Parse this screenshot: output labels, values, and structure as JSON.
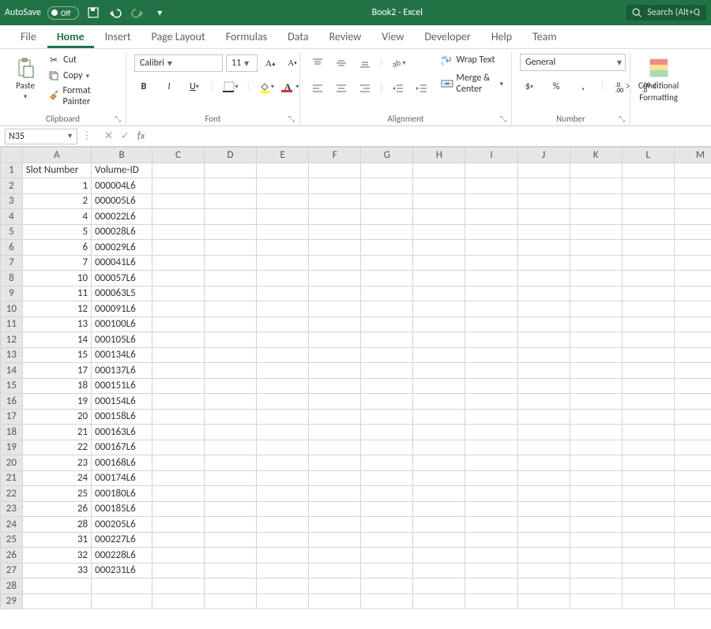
{
  "titlebar": {
    "autosave_label": "AutoSave",
    "autosave_state": "Off",
    "doc_title": "Book2  -  Excel",
    "search_placeholder": "Search (Alt+Q"
  },
  "tabs": [
    "File",
    "Home",
    "Insert",
    "Page Layout",
    "Formulas",
    "Data",
    "Review",
    "View",
    "Developer",
    "Help",
    "Team"
  ],
  "active_tab": "Home",
  "ribbon": {
    "clipboard": {
      "paste": "Paste",
      "cut": "Cut",
      "copy": "Copy",
      "format_painter": "Format Painter",
      "label": "Clipboard"
    },
    "font": {
      "font_name": "Calibri",
      "font_size": "11",
      "label": "Font"
    },
    "alignment": {
      "wrap": "Wrap Text",
      "merge": "Merge & Center",
      "label": "Alignment"
    },
    "number": {
      "format": "General",
      "label": "Number"
    },
    "cond": {
      "label1": "Conditional",
      "label2": "Formatting"
    }
  },
  "fx": {
    "name_box": "N35",
    "fx_label": "fx",
    "formula": ""
  },
  "columns": [
    "A",
    "B",
    "C",
    "D",
    "E",
    "F",
    "G",
    "H",
    "I",
    "J",
    "K",
    "L",
    "M"
  ],
  "headers": {
    "A": "Slot Number",
    "B": "Volume-ID"
  },
  "rows": [
    {
      "n": 1,
      "a": "Slot Number",
      "b": "Volume-ID",
      "hdr": true
    },
    {
      "n": 2,
      "a": "1",
      "b": "000004L6"
    },
    {
      "n": 3,
      "a": "2",
      "b": "000005L6"
    },
    {
      "n": 4,
      "a": "4",
      "b": "000022L6"
    },
    {
      "n": 5,
      "a": "5",
      "b": "000028L6"
    },
    {
      "n": 6,
      "a": "6",
      "b": "000029L6"
    },
    {
      "n": 7,
      "a": "7",
      "b": "000041L6"
    },
    {
      "n": 8,
      "a": "10",
      "b": "000057L6"
    },
    {
      "n": 9,
      "a": "11",
      "b": "000063L5"
    },
    {
      "n": 10,
      "a": "12",
      "b": "000091L6"
    },
    {
      "n": 11,
      "a": "13",
      "b": "000100L6"
    },
    {
      "n": 12,
      "a": "14",
      "b": "000105L6"
    },
    {
      "n": 13,
      "a": "15",
      "b": "000134L6"
    },
    {
      "n": 14,
      "a": "17",
      "b": "000137L6"
    },
    {
      "n": 15,
      "a": "18",
      "b": "000151L6"
    },
    {
      "n": 16,
      "a": "19",
      "b": "000154L6"
    },
    {
      "n": 17,
      "a": "20",
      "b": "000158L6"
    },
    {
      "n": 18,
      "a": "21",
      "b": "000163L6"
    },
    {
      "n": 19,
      "a": "22",
      "b": "000167L6"
    },
    {
      "n": 20,
      "a": "23",
      "b": "000168L6"
    },
    {
      "n": 21,
      "a": "24",
      "b": "000174L6"
    },
    {
      "n": 22,
      "a": "25",
      "b": "000180L6"
    },
    {
      "n": 23,
      "a": "26",
      "b": "000185L6"
    },
    {
      "n": 24,
      "a": "28",
      "b": "000205L6"
    },
    {
      "n": 25,
      "a": "31",
      "b": "000227L6"
    },
    {
      "n": 26,
      "a": "32",
      "b": "000228L6"
    },
    {
      "n": 27,
      "a": "33",
      "b": "000231L6"
    },
    {
      "n": 28,
      "a": "",
      "b": ""
    },
    {
      "n": 29,
      "a": "",
      "b": ""
    }
  ]
}
